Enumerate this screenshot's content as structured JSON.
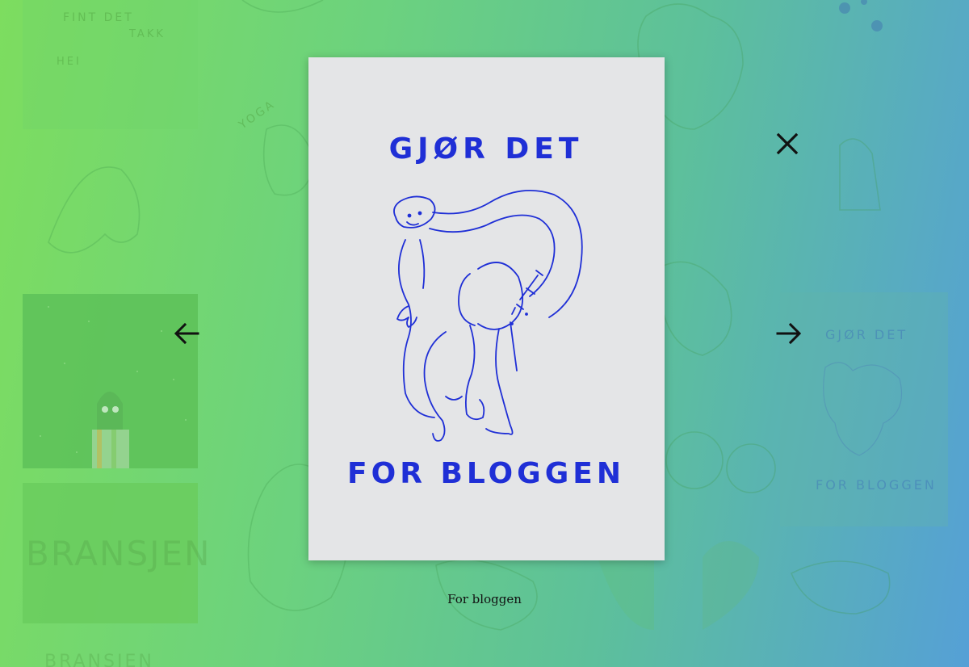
{
  "poster": {
    "top_text": "GJØR DET",
    "bottom_text": "FOR BLOGGEN"
  },
  "caption": "For bloggen",
  "background": {
    "texts": [
      "FINT DET",
      "TAKK",
      "HEI",
      "YOGA",
      "BRANSJEN",
      "BRANSJEN"
    ],
    "thumb_top": "GJØR DET",
    "thumb_bottom": "FOR BLOGGEN"
  },
  "controls": {
    "prev_icon": "arrow-left-icon",
    "next_icon": "arrow-right-icon",
    "close_icon": "close-icon"
  },
  "colors": {
    "ink": "#1f2fd6",
    "accent_gradient_start": "#7ddd5f",
    "accent_gradient_end": "#55a0d6"
  }
}
